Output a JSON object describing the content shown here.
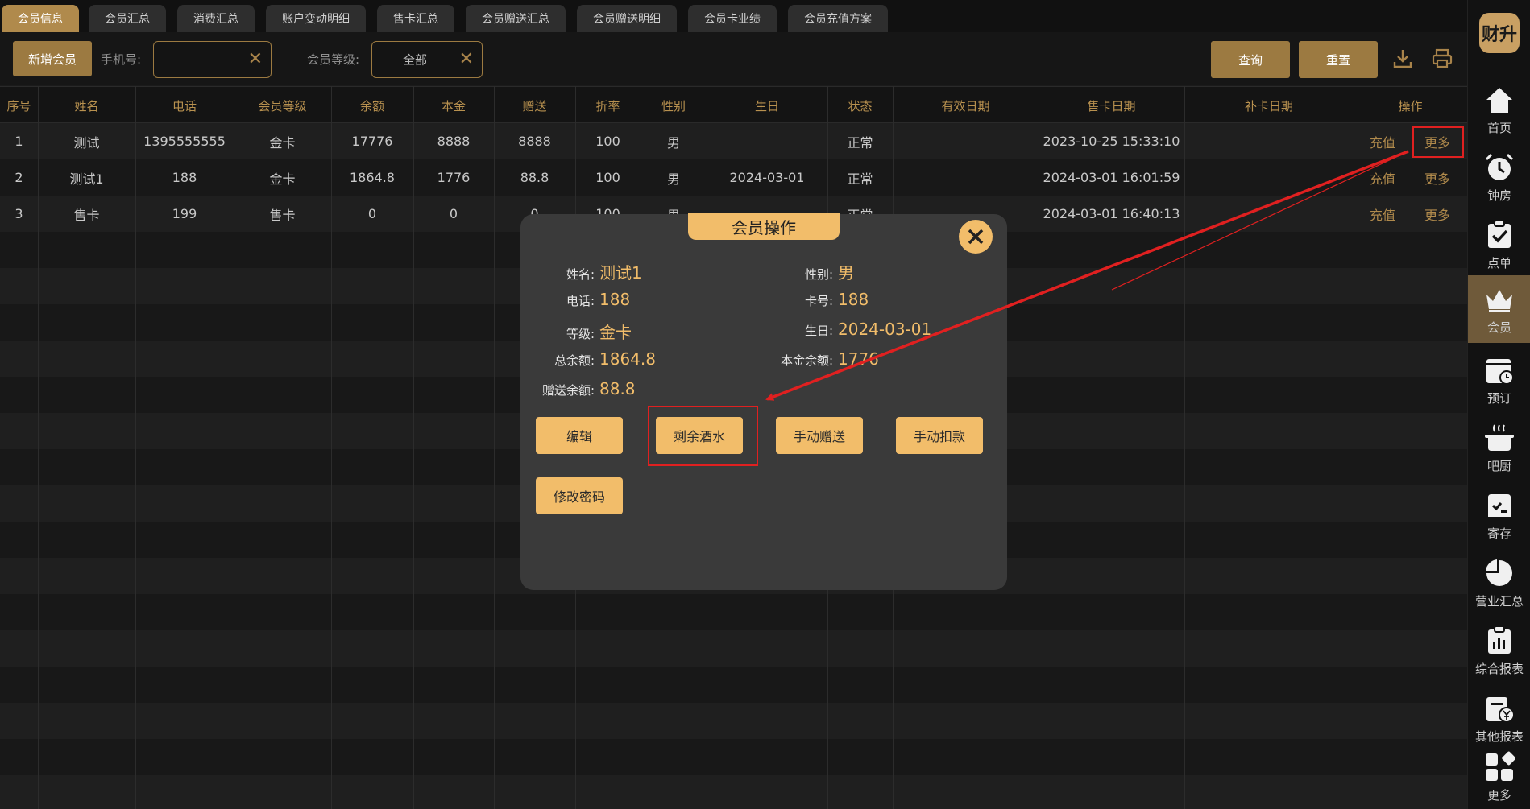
{
  "tabs": [
    "会员信息",
    "会员汇总",
    "消费汇总",
    "账户变动明细",
    "售卡汇总",
    "会员赠送汇总",
    "会员赠送明细",
    "会员卡业绩",
    "会员充值方案"
  ],
  "toolbar": {
    "add_member": "新增会员",
    "phone_label": "手机号:",
    "phone_value": "",
    "level_label": "会员等级:",
    "level_value": "全部",
    "query": "查询",
    "reset": "重置",
    "download_icon": "download-icon",
    "print_icon": "printer-icon"
  },
  "table": {
    "headers": [
      "序号",
      "姓名",
      "电话",
      "会员等级",
      "余额",
      "本金",
      "赠送",
      "折率",
      "性别",
      "生日",
      "状态",
      "有效日期",
      "售卡日期",
      "补卡日期",
      "操作"
    ],
    "rows": [
      [
        "1",
        "测试",
        "1395555555",
        "金卡",
        "17776",
        "8888",
        "8888",
        "100",
        "男",
        "",
        "正常",
        "",
        "2023-10-25 15:33:10",
        ""
      ],
      [
        "2",
        "测试1",
        "188",
        "金卡",
        "1864.8",
        "1776",
        "88.8",
        "100",
        "男",
        "2024-03-01",
        "正常",
        "",
        "2024-03-01 16:01:59",
        ""
      ],
      [
        "3",
        "售卡",
        "199",
        "售卡",
        "0",
        "0",
        "0",
        "100",
        "男",
        "",
        "正常",
        "",
        "2024-03-01 16:40:13",
        ""
      ]
    ],
    "op_recharge": "充值",
    "op_more": "更多"
  },
  "sidebar": {
    "logo": "财升",
    "items": [
      {
        "label": "首页",
        "icon": "home-icon"
      },
      {
        "label": "钟房",
        "icon": "alarm-clock-icon"
      },
      {
        "label": "点单",
        "icon": "clipboard-check-icon"
      },
      {
        "label": "会员",
        "icon": "crown-icon",
        "active": true
      },
      {
        "label": "预订",
        "icon": "calendar-clock-icon"
      },
      {
        "label": "吧厨",
        "icon": "cooking-pot-icon"
      },
      {
        "label": "寄存",
        "icon": "storage-icon"
      },
      {
        "label": "营业汇总",
        "icon": "pie-chart-icon"
      },
      {
        "label": "综合报表",
        "icon": "bar-report-icon"
      },
      {
        "label": "其他报表",
        "icon": "yuan-report-icon"
      },
      {
        "label": "更多",
        "icon": "more-grid-icon"
      }
    ]
  },
  "modal": {
    "title": "会员操作",
    "close_icon": "close-icon",
    "fields": {
      "name_k": "姓名:",
      "name_v": "测试1",
      "gender_k": "性别:",
      "gender_v": "男",
      "phone_k": "电话:",
      "phone_v": "188",
      "card_k": "卡号:",
      "card_v": "188",
      "level_k": "等级:",
      "level_v": "金卡",
      "birthday_k": "生日:",
      "birthday_v": "2024-03-01",
      "total_k": "总余额:",
      "total_v": "1864.8",
      "principal_k": "本金余额:",
      "principal_v": "1776",
      "gift_k": "赠送余额:",
      "gift_v": "88.8"
    },
    "buttons": {
      "edit": "编辑",
      "remaining_drinks": "剩余酒水",
      "manual_gift": "手动赠送",
      "manual_deduct": "手动扣款",
      "change_password": "修改密码"
    }
  },
  "colors": {
    "accent": "#f2bd6a",
    "gold_dark": "#9c7a41",
    "annotation_red": "#e02020"
  }
}
